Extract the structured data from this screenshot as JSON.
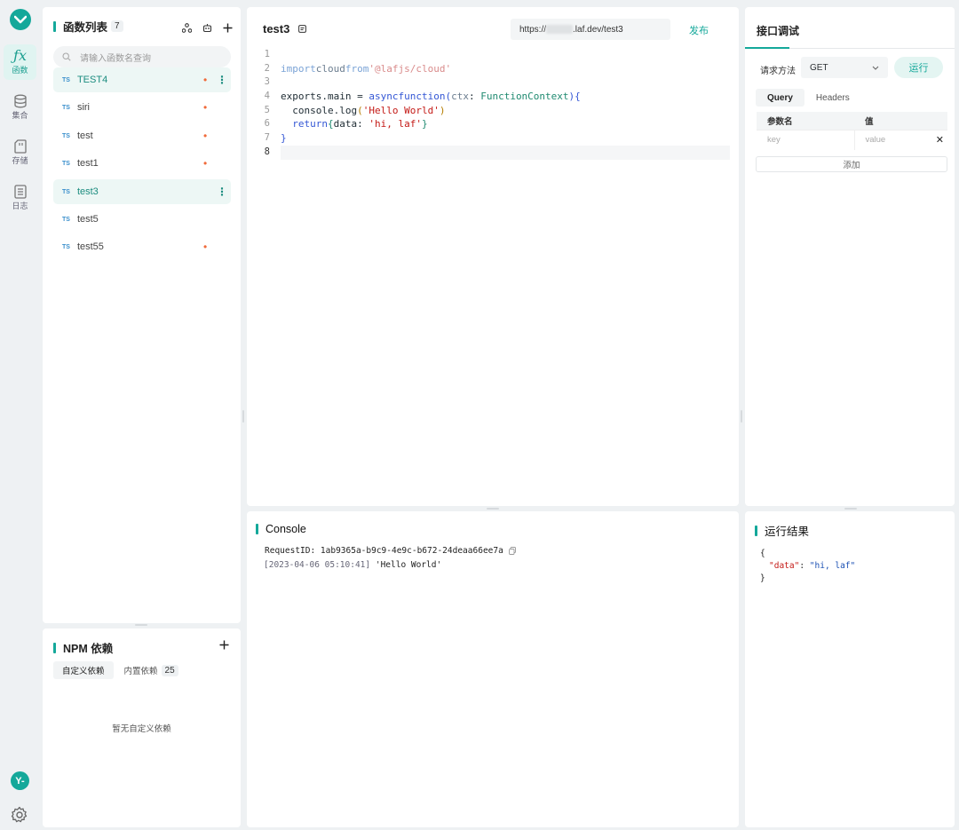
{
  "rail": {
    "items": [
      {
        "label": "函数",
        "active": true
      },
      {
        "label": "集合"
      },
      {
        "label": "存储"
      },
      {
        "label": "日志"
      }
    ],
    "avatar_text": "Y-"
  },
  "functions": {
    "title": "函数列表",
    "count": "7",
    "search_placeholder": "请输入函数名查询",
    "items": [
      {
        "name": "TEST4",
        "tag": "TS",
        "changed": true,
        "active": true,
        "menu": true
      },
      {
        "name": "siri",
        "tag": "TS",
        "changed": true
      },
      {
        "name": "test",
        "tag": "TS",
        "changed": true
      },
      {
        "name": "test1",
        "tag": "TS",
        "changed": true
      },
      {
        "name": "test3",
        "tag": "TS",
        "changed": false,
        "active": true,
        "menu": true
      },
      {
        "name": "test5",
        "tag": "TS",
        "changed": false
      },
      {
        "name": "test55",
        "tag": "TS",
        "changed": true
      }
    ]
  },
  "npm": {
    "title": "NPM 依赖",
    "tabs": [
      {
        "label": "自定义依赖",
        "active": true
      },
      {
        "label": "内置依赖",
        "count": "25"
      }
    ],
    "empty_text": "暂无自定义依赖"
  },
  "editor": {
    "tab_title": "test3",
    "url_prefix": "https://",
    "url_suffix": ".laf.dev/test3",
    "publish_label": "发布",
    "line_numbers": [
      "1",
      "2",
      "3",
      "4",
      "5",
      "6",
      "7",
      "8"
    ]
  },
  "console": {
    "title": "Console",
    "request_id": "RequestID: 1ab9365a-b9c9-4e9c-b672-24deaa66ee7a",
    "log_time": "[2023-04-06 05:10:41]",
    "log_text": "'Hello World'"
  },
  "api": {
    "title": "接口调试",
    "method_label": "请求方法",
    "method_value": "GET",
    "run_label": "运行",
    "tabs": [
      "Query",
      "Headers"
    ],
    "col_name": "参数名",
    "col_value": "值",
    "key_placeholder": "key",
    "value_placeholder": "value",
    "add_label": "添加"
  },
  "result": {
    "title": "运行结果",
    "open": "{",
    "key": "\"data\"",
    "colon": ": ",
    "value": "\"hi, laf\"",
    "close": "}"
  },
  "colors": {
    "accent": "#14a89a",
    "changed_dot": "#f06a3a"
  }
}
